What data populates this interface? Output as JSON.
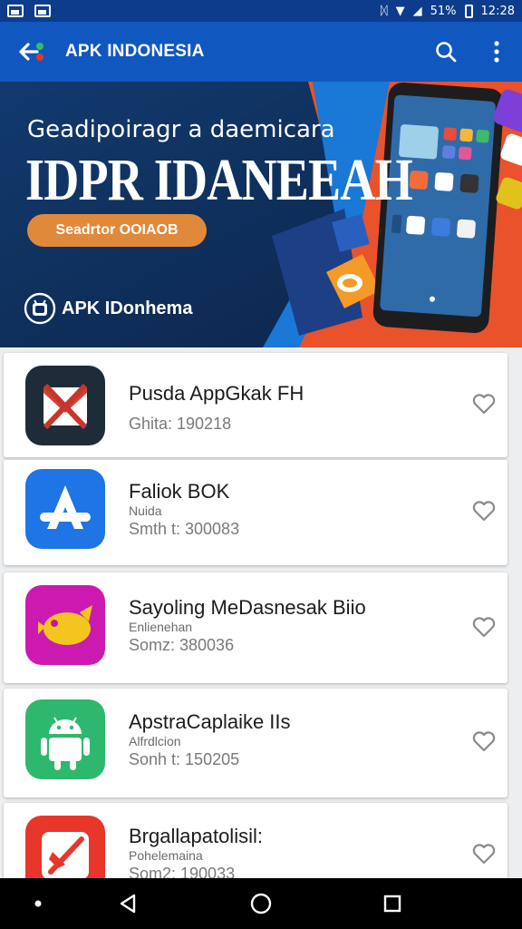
{
  "status_bar": {
    "battery": "51%",
    "time": "12:28",
    "icons": [
      "notification-image-icon",
      "notification-image-icon",
      "vibrate-icon",
      "wifi-icon",
      "signal-icon",
      "battery-icon"
    ]
  },
  "app_bar": {
    "title": "APK INDONESIA",
    "icons": [
      "app-logo-back-icon",
      "search-icon",
      "more-vert-icon"
    ]
  },
  "banner": {
    "headline": "Geadipoiragr a daemicara",
    "big_text": "IDPR IDANEEAH",
    "cta_label": "Seadrtor OOIAOB",
    "brand_label": "APK IDonhema"
  },
  "apps": [
    {
      "name": "Pusda AppGkak FH",
      "subtitle": "",
      "size": "Ghita: 190218"
    },
    {
      "name": "Faliok BOK",
      "subtitle": "Nuida",
      "size": "Smth t: 300083"
    },
    {
      "name": "Sayoling MeDasnesak Biio",
      "subtitle": "Enlienehan",
      "size": "Somz: 380036"
    },
    {
      "name": "ApstraCaplaike IIs",
      "subtitle": "Alfrdlcion",
      "size": "Sonh t: 150205"
    },
    {
      "name": "Brgallapatolisil:",
      "subtitle": "Pohelemaina",
      "size": "Som2: 190033"
    }
  ],
  "nav": {
    "icons": [
      "dot-icon",
      "back-triangle-icon",
      "home-circle-icon",
      "recents-square-icon"
    ]
  },
  "colors": {
    "app_bar": "#1157c0",
    "status_bar": "#0d3c8c",
    "cta": "#e0893a",
    "banner_orange": "#e9522b"
  }
}
